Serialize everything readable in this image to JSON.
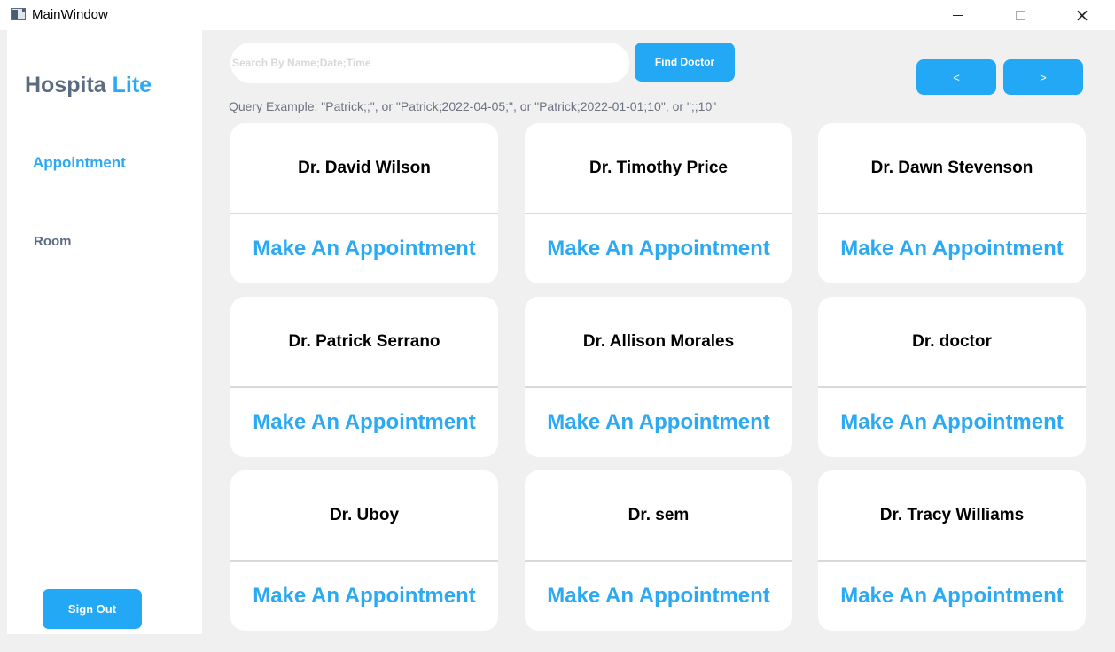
{
  "window": {
    "title": "MainWindow",
    "controls": {
      "minimize": "minimize",
      "maximize": "maximize",
      "close": "×"
    }
  },
  "sidebar": {
    "brand_part1": "Hospita",
    "brand_part2": "Lite",
    "nav": [
      {
        "label": "Appointment",
        "active": true
      },
      {
        "label": "Room",
        "active": false
      }
    ],
    "signout_label": "Sign Out"
  },
  "search": {
    "placeholder": "Search By Name;Date;Time",
    "value": "",
    "find_label": "Find Doctor",
    "hint": "Query Example: \"Patrick;;\", or \"Patrick;2022-04-05;\", or \"Patrick;2022-01-01;10\", or \";;10\""
  },
  "pager": {
    "prev_label": "<",
    "next_label": ">"
  },
  "doctors": [
    {
      "name": "Dr. David Wilson",
      "action": "Make An Appointment"
    },
    {
      "name": "Dr. Timothy Price",
      "action": "Make An Appointment"
    },
    {
      "name": "Dr. Dawn Stevenson",
      "action": "Make An Appointment"
    },
    {
      "name": "Dr. Patrick Serrano",
      "action": "Make An Appointment"
    },
    {
      "name": "Dr. Allison Morales",
      "action": "Make An Appointment"
    },
    {
      "name": "Dr. doctor",
      "action": "Make An Appointment"
    },
    {
      "name": "Dr. Uboy",
      "action": "Make An Appointment"
    },
    {
      "name": "Dr. sem",
      "action": "Make An Appointment"
    },
    {
      "name": "Dr. Tracy Williams",
      "action": "Make An Appointment"
    }
  ],
  "colors": {
    "accent": "#2ba9f2",
    "button": "#22a8f5",
    "brand_gray": "#5a6b80",
    "background": "#f0f0f0"
  }
}
